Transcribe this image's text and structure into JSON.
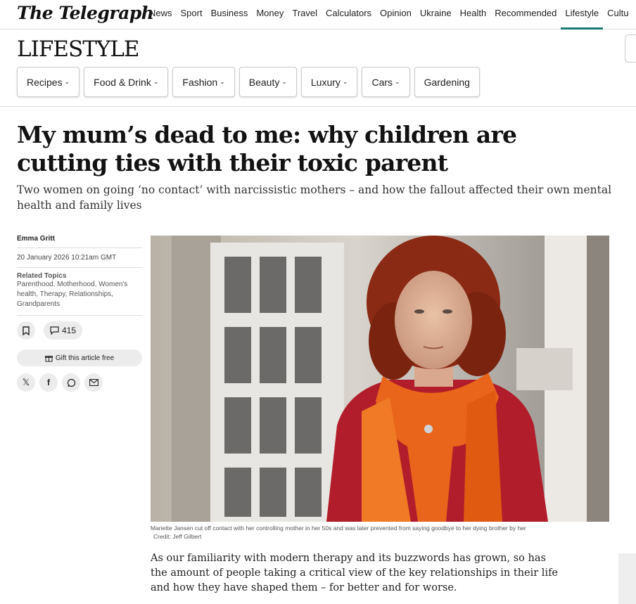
{
  "brand": {
    "logo": "The Telegraph"
  },
  "nav": {
    "items": [
      "News",
      "Sport",
      "Business",
      "Money",
      "Travel",
      "Calculators",
      "Opinion",
      "Ukraine",
      "Health",
      "Recommended",
      "Lifestyle",
      "Cultu"
    ],
    "active": "Lifestyle",
    "accent_color": "#1a7a73"
  },
  "section": {
    "title": "LIFESTYLE",
    "subnav": [
      {
        "label": "Recipes",
        "has_dropdown": true
      },
      {
        "label": "Food & Drink",
        "has_dropdown": true
      },
      {
        "label": "Fashion",
        "has_dropdown": true
      },
      {
        "label": "Beauty",
        "has_dropdown": true
      },
      {
        "label": "Luxury",
        "has_dropdown": true
      },
      {
        "label": "Cars",
        "has_dropdown": true
      },
      {
        "label": "Gardening",
        "has_dropdown": false
      }
    ]
  },
  "article": {
    "headline": "My mum’s dead to me: why children are cutting ties with their toxic parent",
    "standfirst": "Two women on going ‘no contact’ with narcissistic mothers – and how the fallout affected their own mental health and family lives",
    "author": "Emma Gritt",
    "date": "20 January 2026 10:21am GMT",
    "related_topics_label": "Related Topics",
    "related_topics": "Parenthood, Motherhood, Women's health, Therapy, Relationships, Grandparents",
    "comment_count": "415",
    "gift_label": "Gift this article free",
    "share_icons": [
      "x-icon",
      "facebook-icon",
      "whatsapp-icon",
      "email-icon"
    ],
    "caption": "Mariette Jansen cut off contact with her controlling mother in her 50s and was later prevented from saying goodbye to her dying brother by her",
    "credit": "Credit: Jeff Gilbert",
    "body": "As our familiarity with modern therapy and its buzzwords has grown, so has the amount of people taking a critical view of the key relationships in their life and how they have shaped them – for better and for worse."
  }
}
